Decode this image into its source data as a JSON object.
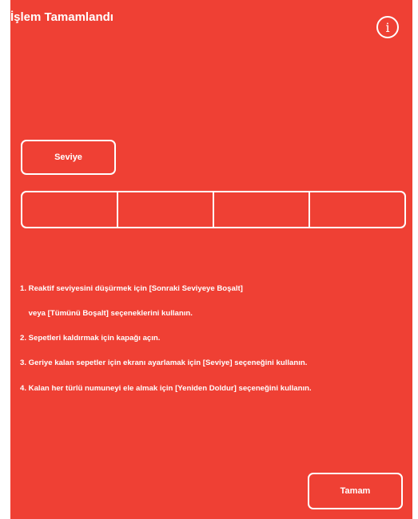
{
  "header": {
    "title": "İşlem Tamamlandı",
    "info_icon": "info-icon",
    "info_glyph": "i"
  },
  "level_button": {
    "label": "Seviye"
  },
  "level_slots": {
    "count": 4,
    "selected": []
  },
  "instructions": [
    "1. Reaktif seviyesini düşürmek için [Sonraki Seviyeye Boşalt]",
    "    veya [Tümünü Boşalt] seçeneklerini kullanın.",
    "2. Sepetleri kaldırmak için kapağı açın.",
    "3. Geriye kalan sepetler için ekranı ayarlamak için [Seviye] seçeneğini kullanın.",
    "4. Kalan her türlü numuneyi ele almak için [Yeniden Doldur] seçeneğini kullanın."
  ],
  "footer": {
    "ok_label": "Tamam"
  },
  "colors": {
    "background": "#ef4034",
    "foreground": "#ffffff"
  }
}
